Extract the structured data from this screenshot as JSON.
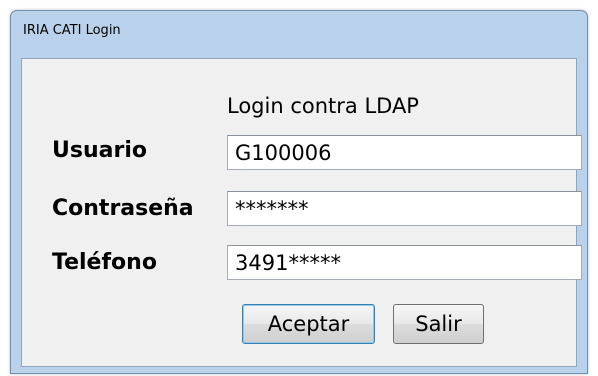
{
  "window": {
    "title": "IRIA CATI Login"
  },
  "form": {
    "subtitle": "Login contra LDAP",
    "fields": [
      {
        "label": "Usuario",
        "value": "G100006"
      },
      {
        "label": "Contraseña",
        "value": "*******"
      },
      {
        "label": "Teléfono",
        "value": "3491*****"
      }
    ]
  },
  "buttons": {
    "accept_label": "Aceptar",
    "exit_label": "Salir"
  }
}
